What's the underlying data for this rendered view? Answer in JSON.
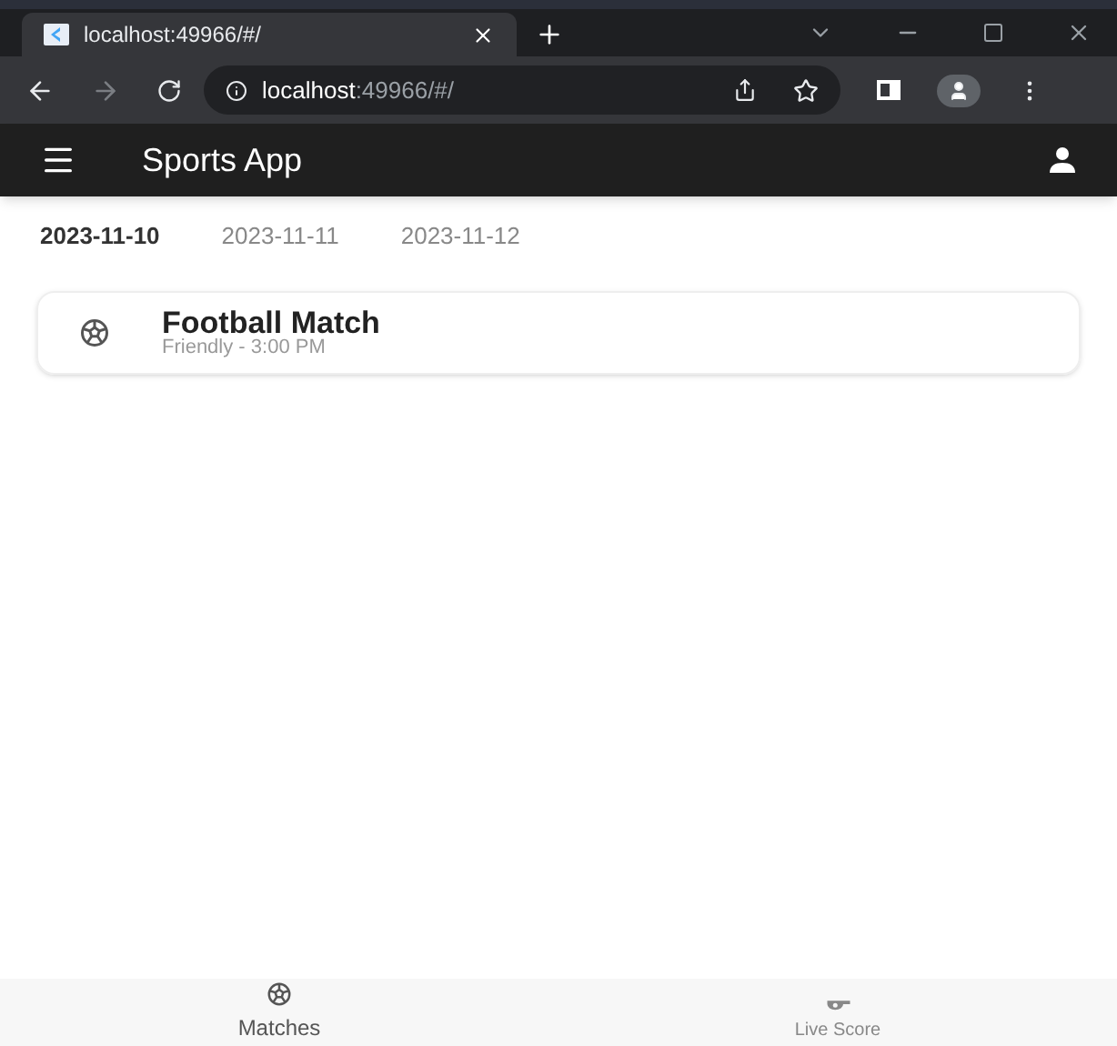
{
  "browser": {
    "tab_title": "localhost:49966/#/",
    "url": {
      "host": "localhost",
      "rest": ":49966/#/"
    }
  },
  "app_bar": {
    "title": "Sports App"
  },
  "date_tabs": [
    {
      "label": "2023-11-10",
      "selected": true
    },
    {
      "label": "2023-11-11",
      "selected": false
    },
    {
      "label": "2023-11-12",
      "selected": false
    }
  ],
  "matches": [
    {
      "title": "Football Match",
      "subtitle": "Friendly - 3:00 PM"
    }
  ],
  "bottom_nav": [
    {
      "label": "Matches",
      "kind": "ball",
      "selected": true
    },
    {
      "label": "Live Score",
      "kind": "whistle",
      "selected": false
    }
  ]
}
